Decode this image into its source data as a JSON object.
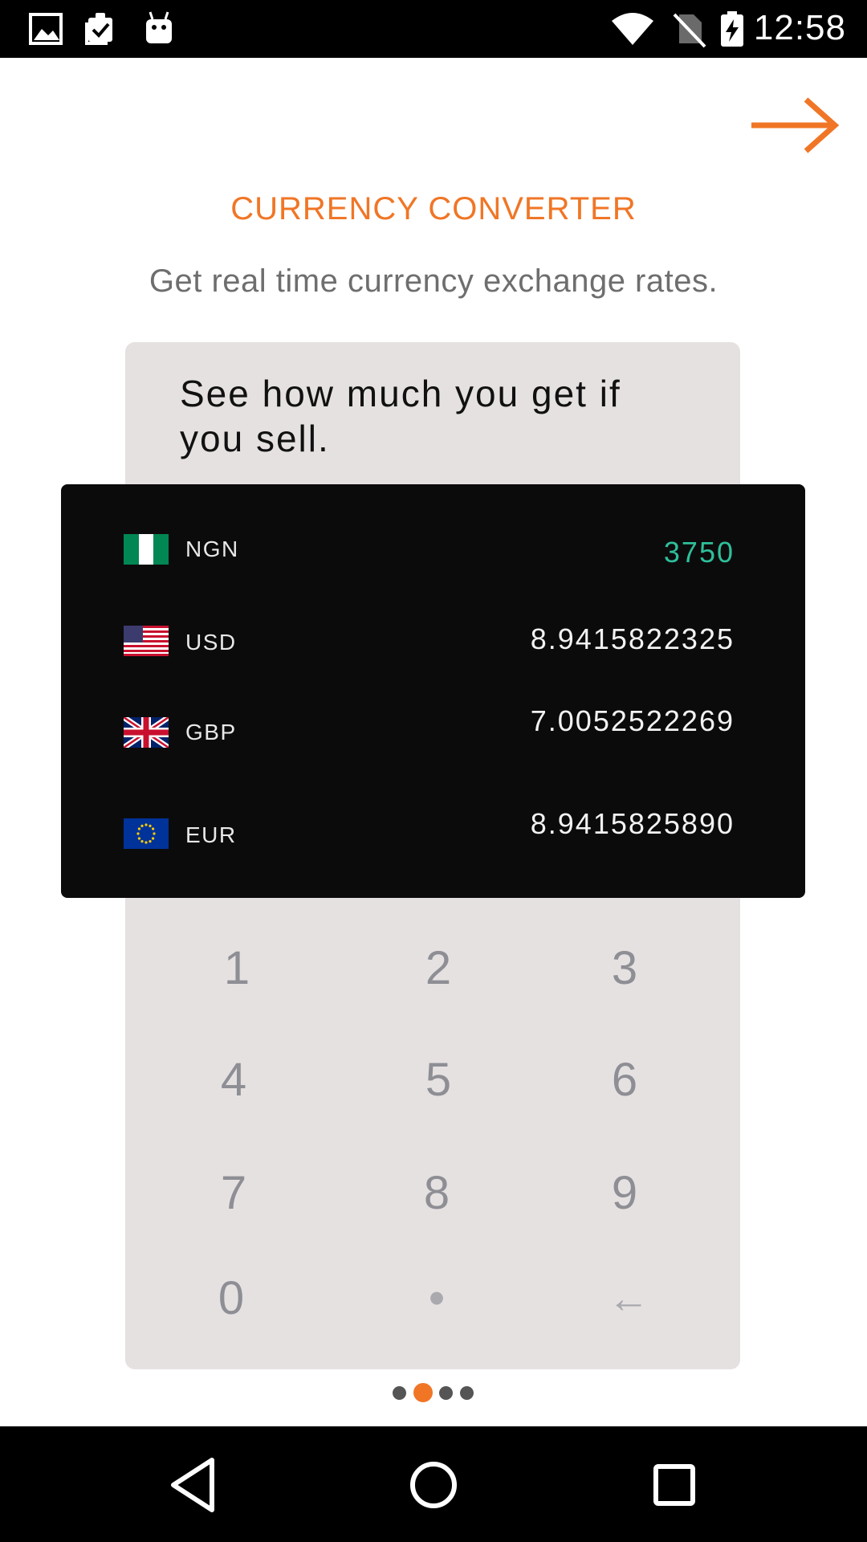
{
  "status_bar": {
    "time": "12:58",
    "left_icons": [
      "image-icon",
      "clipboard-check-icon",
      "android-icon"
    ],
    "right_icons": [
      "wifi-icon",
      "no-sim-icon",
      "battery-charging-icon"
    ]
  },
  "header": {
    "next_icon": "arrow-right-icon"
  },
  "colors": {
    "accent": "#f07626",
    "highlight": "#2ebf9a",
    "card_bg": "#e6e1e1",
    "panel_bg": "#0c0b0c"
  },
  "intro": {
    "title": "CURRENCY CONVERTER",
    "subtitle": "Get real time currency exchange rates."
  },
  "card": {
    "heading": "See how much you get if you sell."
  },
  "currencies": [
    {
      "code": "NGN",
      "value": "3750",
      "flag": "nigeria-flag-icon"
    },
    {
      "code": "USD",
      "value": "8.9415822325",
      "flag": "usa-flag-icon"
    },
    {
      "code": "GBP",
      "value": "7.0052522269",
      "flag": "uk-flag-icon"
    },
    {
      "code": "EUR",
      "value": "8.9415825890",
      "flag": "eu-flag-icon"
    }
  ],
  "keypad": {
    "keys": [
      "1",
      "2",
      "3",
      "4",
      "5",
      "6",
      "7",
      "8",
      "9",
      "0",
      "•",
      "←"
    ]
  },
  "pager": {
    "total": 4,
    "active_index": 1
  },
  "nav_bar": {
    "buttons": [
      "back-icon",
      "home-icon",
      "recents-icon"
    ]
  }
}
